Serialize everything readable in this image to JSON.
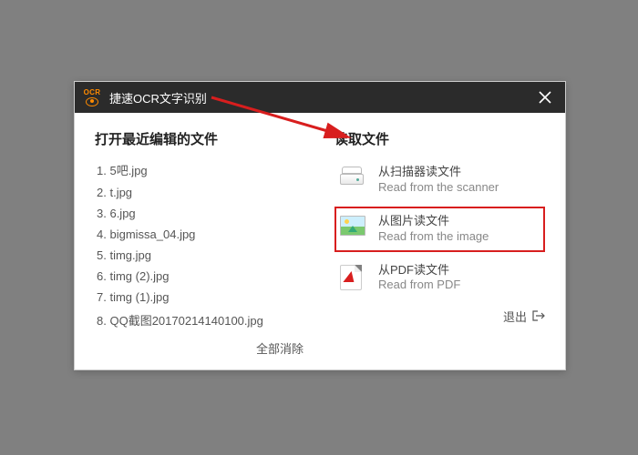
{
  "titlebar": {
    "title": "捷速OCR文字识别",
    "logo_text": "OCR"
  },
  "left": {
    "heading": "打开最近编辑的文件",
    "files": [
      "5吧.jpg",
      "t.jpg",
      "6.jpg",
      "bigmissa_04.jpg",
      "timg.jpg",
      "timg (2).jpg",
      "timg (1).jpg",
      "QQ截图20170214140100.jpg"
    ],
    "clear_all": "全部消除"
  },
  "right": {
    "heading": "读取文件",
    "options": [
      {
        "id": "scanner",
        "cn": "从扫描器读文件",
        "en": "Read from the scanner",
        "highlight": false
      },
      {
        "id": "image",
        "cn": "从图片读文件",
        "en": "Read from the image",
        "highlight": true
      },
      {
        "id": "pdf",
        "cn": "从PDF读文件",
        "en": "Read from PDF",
        "highlight": false
      }
    ],
    "exit": "退出"
  }
}
